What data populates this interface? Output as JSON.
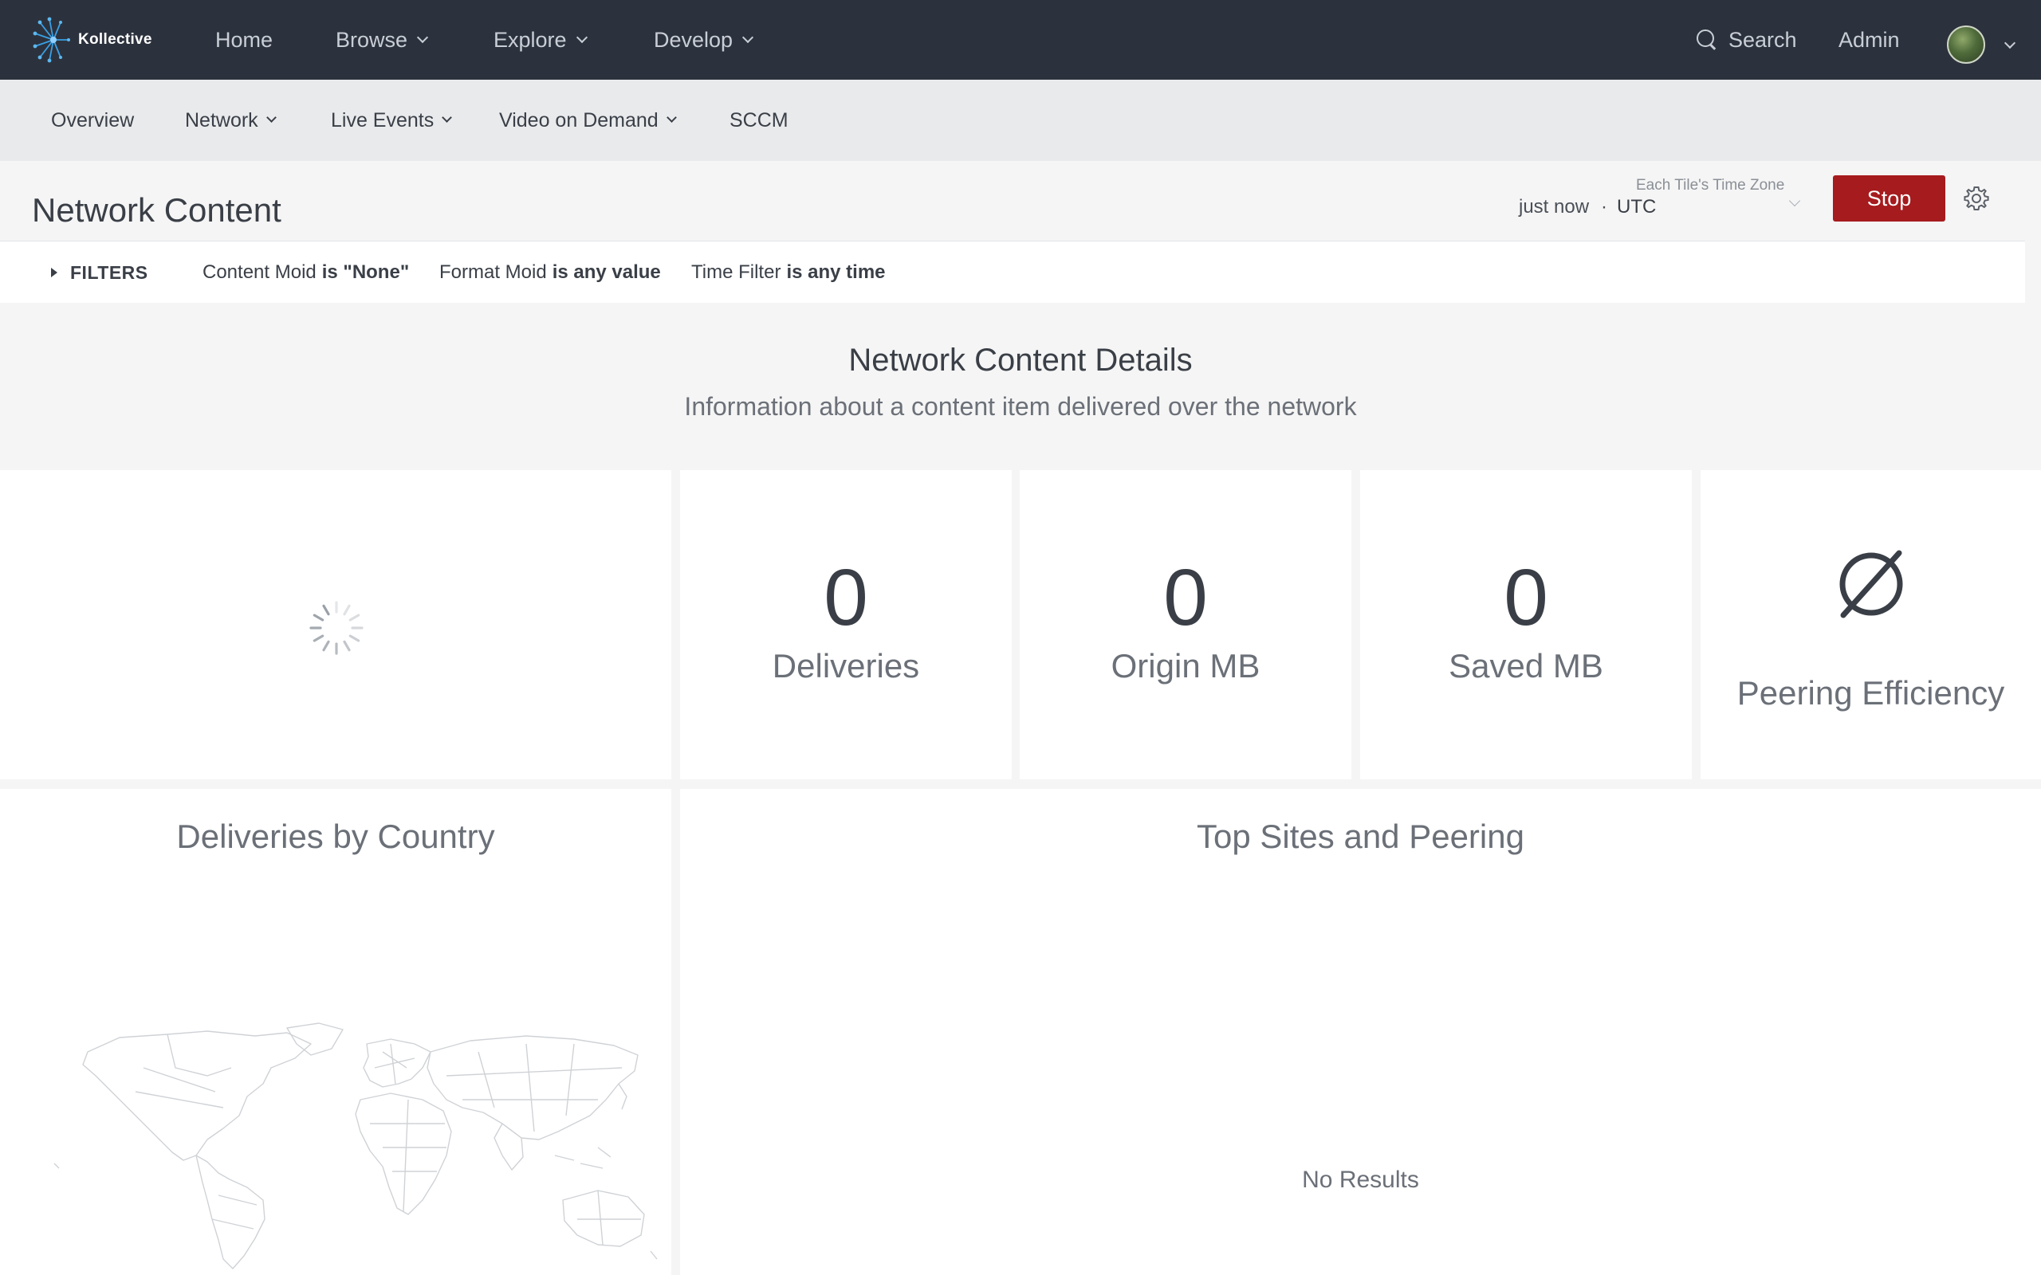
{
  "brand": {
    "name": "Kollective"
  },
  "topnav": {
    "items": [
      {
        "label": "Home",
        "dropdown": false
      },
      {
        "label": "Browse",
        "dropdown": true
      },
      {
        "label": "Explore",
        "dropdown": true
      },
      {
        "label": "Develop",
        "dropdown": true
      }
    ],
    "search_label": "Search",
    "admin_label": "Admin",
    "avatar_icon": "user-avatar"
  },
  "subnav": {
    "items": [
      {
        "label": "Overview",
        "dropdown": false
      },
      {
        "label": "Network",
        "dropdown": true
      },
      {
        "label": "Live Events",
        "dropdown": true
      },
      {
        "label": "Video on Demand",
        "dropdown": true
      },
      {
        "label": "SCCM",
        "dropdown": false
      }
    ]
  },
  "header": {
    "title": "Network Content",
    "timezone_label": "Each Tile's Time Zone",
    "refreshed": "just now",
    "separator": "·",
    "timezone_value": "UTC",
    "stop_label": "Stop",
    "settings_icon": "gear-icon"
  },
  "filters": {
    "label": "FILTERS",
    "chips": [
      {
        "field": "Content Moid",
        "value": "is \"None\""
      },
      {
        "field": "Format Moid",
        "value": "is any value"
      },
      {
        "field": "Time Filter",
        "value": "is any time"
      }
    ]
  },
  "dashboard": {
    "title": "Network Content Details",
    "subtitle": "Information about a content item delivered over the network"
  },
  "tiles": {
    "loading_icon": "spinner-icon",
    "deliveries": {
      "value": "0",
      "label": "Deliveries"
    },
    "origin": {
      "value": "0",
      "label": "Origin MB"
    },
    "saved": {
      "value": "0",
      "label": "Saved MB"
    },
    "peering": {
      "value_icon": "empty-set-icon",
      "label": "Peering Efficiency"
    },
    "country": {
      "title": "Deliveries by Country",
      "map_icon": "world-map-icon"
    },
    "sites": {
      "title": "Top Sites and Peering",
      "empty": "No Results"
    }
  },
  "colors": {
    "topnav_bg": "#2c323d",
    "subnav_bg": "#e9eaec",
    "page_bg": "#f5f5f5",
    "stop_button": "#a51b1e",
    "brand_accent": "#3aa0e6"
  }
}
